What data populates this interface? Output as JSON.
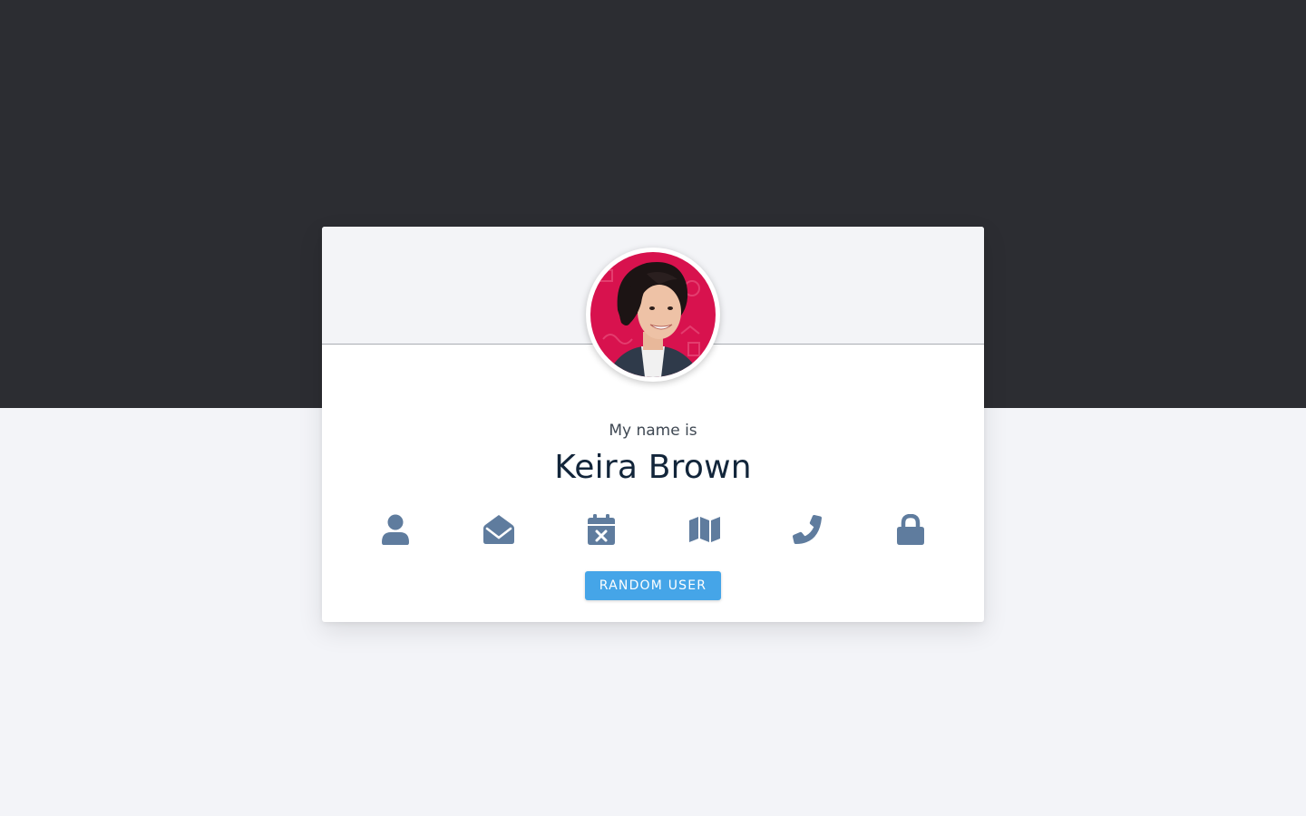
{
  "colors": {
    "top_background": "#2c2d32",
    "bottom_background": "#f3f4f8",
    "icon": "#5f7c9e",
    "button": "#45a5e8",
    "avatar_background": "#d8124e"
  },
  "profile": {
    "title": "My name is",
    "value": "Keira Brown"
  },
  "icons": [
    {
      "name": "user-icon"
    },
    {
      "name": "envelope-open-icon"
    },
    {
      "name": "calendar-times-icon"
    },
    {
      "name": "map-icon"
    },
    {
      "name": "phone-icon"
    },
    {
      "name": "lock-icon"
    }
  ],
  "button": {
    "label": "RANDOM USER"
  }
}
